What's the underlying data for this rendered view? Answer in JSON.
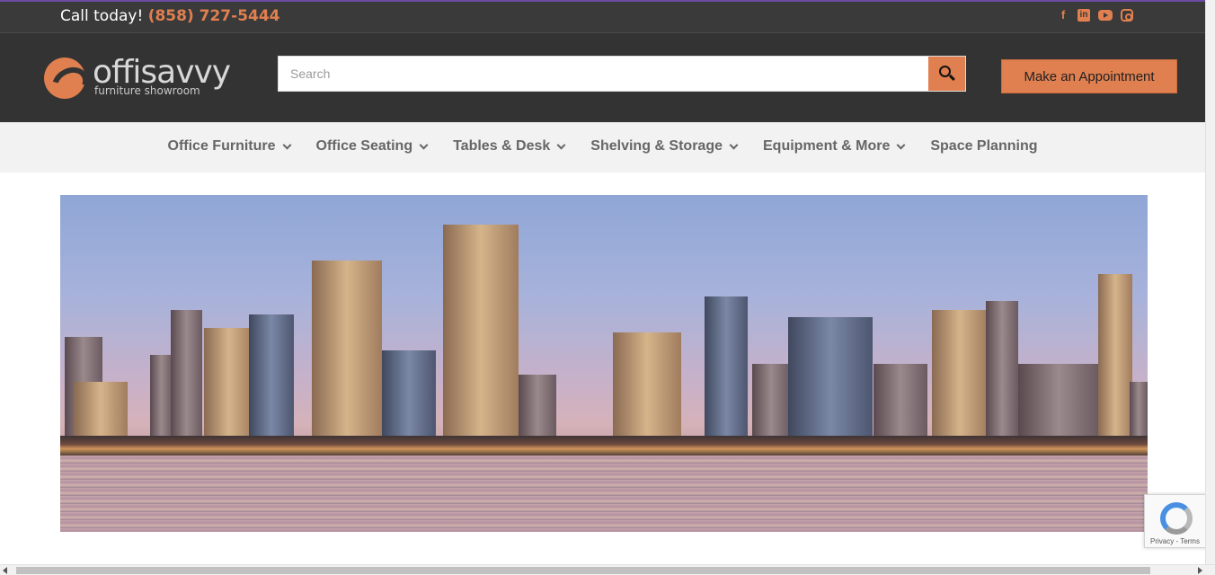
{
  "topbar": {
    "call_label": "Call today!",
    "phone": "(858) 727-5444",
    "social": [
      "facebook-icon",
      "linkedin-icon",
      "youtube-icon",
      "instagram-icon"
    ]
  },
  "header": {
    "logo_name": "offisavvy",
    "logo_tagline": "furniture showroom",
    "search_placeholder": "Search",
    "appointment_label": "Make an Appointment"
  },
  "nav": {
    "items": [
      {
        "label": "Office Furniture",
        "dropdown": true
      },
      {
        "label": "Office Seating",
        "dropdown": true
      },
      {
        "label": "Tables & Desk",
        "dropdown": true
      },
      {
        "label": "Shelving & Storage",
        "dropdown": true
      },
      {
        "label": "Equipment & More",
        "dropdown": true
      },
      {
        "label": "Space Planning",
        "dropdown": false
      }
    ]
  },
  "recaptcha": {
    "terms": "Privacy - Terms"
  },
  "colors": {
    "accent": "#e07f4f",
    "header_bg": "#333333",
    "nav_bg": "#f2f2f2"
  }
}
